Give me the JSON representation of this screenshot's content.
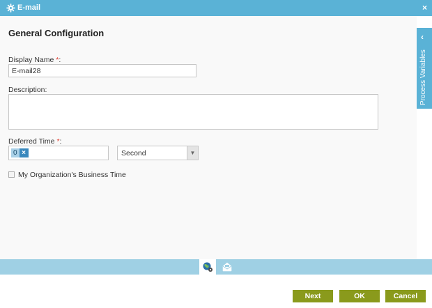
{
  "window": {
    "title": "E-mail",
    "close_glyph": "×"
  },
  "heading": "General Configuration",
  "display_name": {
    "label": "Display Name",
    "required_mark": "*",
    "suffix": ":",
    "value": "E-mail28"
  },
  "description": {
    "label": "Description:",
    "value": ""
  },
  "deferred_time": {
    "label": "Deferred Time",
    "required_mark": "*",
    "suffix": ":",
    "chip_value": "0",
    "chip_remove": "×",
    "unit_selected": "Second",
    "dropdown_arrow": "▼"
  },
  "business_time": {
    "label": "My Organization's Business Time",
    "checked": false
  },
  "side_panel": {
    "label": "Process Variables",
    "chevron": "‹"
  },
  "bottom_tabs": [
    {
      "icon": "globe-settings-icon",
      "active": true
    },
    {
      "icon": "envelope-icon",
      "active": false
    }
  ],
  "buttons": {
    "next": "Next",
    "ok": "OK",
    "cancel": "Cancel"
  },
  "colors": {
    "accent": "#5ab2d6",
    "button": "#8a9a1c",
    "required": "#e0392b",
    "tabbar": "#9fd0e4"
  }
}
